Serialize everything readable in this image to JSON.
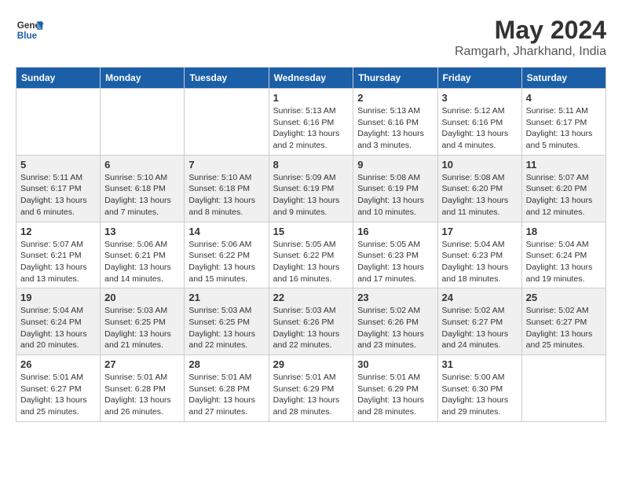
{
  "logo": {
    "line1": "General",
    "line2": "Blue"
  },
  "title": "May 2024",
  "location": "Ramgarh, Jharkhand, India",
  "weekdays": [
    "Sunday",
    "Monday",
    "Tuesday",
    "Wednesday",
    "Thursday",
    "Friday",
    "Saturday"
  ],
  "weeks": [
    [
      {
        "day": "",
        "info": ""
      },
      {
        "day": "",
        "info": ""
      },
      {
        "day": "",
        "info": ""
      },
      {
        "day": "1",
        "info": "Sunrise: 5:13 AM\nSunset: 6:16 PM\nDaylight: 13 hours\nand 2 minutes."
      },
      {
        "day": "2",
        "info": "Sunrise: 5:13 AM\nSunset: 6:16 PM\nDaylight: 13 hours\nand 3 minutes."
      },
      {
        "day": "3",
        "info": "Sunrise: 5:12 AM\nSunset: 6:16 PM\nDaylight: 13 hours\nand 4 minutes."
      },
      {
        "day": "4",
        "info": "Sunrise: 5:11 AM\nSunset: 6:17 PM\nDaylight: 13 hours\nand 5 minutes."
      }
    ],
    [
      {
        "day": "5",
        "info": "Sunrise: 5:11 AM\nSunset: 6:17 PM\nDaylight: 13 hours\nand 6 minutes."
      },
      {
        "day": "6",
        "info": "Sunrise: 5:10 AM\nSunset: 6:18 PM\nDaylight: 13 hours\nand 7 minutes."
      },
      {
        "day": "7",
        "info": "Sunrise: 5:10 AM\nSunset: 6:18 PM\nDaylight: 13 hours\nand 8 minutes."
      },
      {
        "day": "8",
        "info": "Sunrise: 5:09 AM\nSunset: 6:19 PM\nDaylight: 13 hours\nand 9 minutes."
      },
      {
        "day": "9",
        "info": "Sunrise: 5:08 AM\nSunset: 6:19 PM\nDaylight: 13 hours\nand 10 minutes."
      },
      {
        "day": "10",
        "info": "Sunrise: 5:08 AM\nSunset: 6:20 PM\nDaylight: 13 hours\nand 11 minutes."
      },
      {
        "day": "11",
        "info": "Sunrise: 5:07 AM\nSunset: 6:20 PM\nDaylight: 13 hours\nand 12 minutes."
      }
    ],
    [
      {
        "day": "12",
        "info": "Sunrise: 5:07 AM\nSunset: 6:21 PM\nDaylight: 13 hours\nand 13 minutes."
      },
      {
        "day": "13",
        "info": "Sunrise: 5:06 AM\nSunset: 6:21 PM\nDaylight: 13 hours\nand 14 minutes."
      },
      {
        "day": "14",
        "info": "Sunrise: 5:06 AM\nSunset: 6:22 PM\nDaylight: 13 hours\nand 15 minutes."
      },
      {
        "day": "15",
        "info": "Sunrise: 5:05 AM\nSunset: 6:22 PM\nDaylight: 13 hours\nand 16 minutes."
      },
      {
        "day": "16",
        "info": "Sunrise: 5:05 AM\nSunset: 6:23 PM\nDaylight: 13 hours\nand 17 minutes."
      },
      {
        "day": "17",
        "info": "Sunrise: 5:04 AM\nSunset: 6:23 PM\nDaylight: 13 hours\nand 18 minutes."
      },
      {
        "day": "18",
        "info": "Sunrise: 5:04 AM\nSunset: 6:24 PM\nDaylight: 13 hours\nand 19 minutes."
      }
    ],
    [
      {
        "day": "19",
        "info": "Sunrise: 5:04 AM\nSunset: 6:24 PM\nDaylight: 13 hours\nand 20 minutes."
      },
      {
        "day": "20",
        "info": "Sunrise: 5:03 AM\nSunset: 6:25 PM\nDaylight: 13 hours\nand 21 minutes."
      },
      {
        "day": "21",
        "info": "Sunrise: 5:03 AM\nSunset: 6:25 PM\nDaylight: 13 hours\nand 22 minutes."
      },
      {
        "day": "22",
        "info": "Sunrise: 5:03 AM\nSunset: 6:26 PM\nDaylight: 13 hours\nand 22 minutes."
      },
      {
        "day": "23",
        "info": "Sunrise: 5:02 AM\nSunset: 6:26 PM\nDaylight: 13 hours\nand 23 minutes."
      },
      {
        "day": "24",
        "info": "Sunrise: 5:02 AM\nSunset: 6:27 PM\nDaylight: 13 hours\nand 24 minutes."
      },
      {
        "day": "25",
        "info": "Sunrise: 5:02 AM\nSunset: 6:27 PM\nDaylight: 13 hours\nand 25 minutes."
      }
    ],
    [
      {
        "day": "26",
        "info": "Sunrise: 5:01 AM\nSunset: 6:27 PM\nDaylight: 13 hours\nand 25 minutes."
      },
      {
        "day": "27",
        "info": "Sunrise: 5:01 AM\nSunset: 6:28 PM\nDaylight: 13 hours\nand 26 minutes."
      },
      {
        "day": "28",
        "info": "Sunrise: 5:01 AM\nSunset: 6:28 PM\nDaylight: 13 hours\nand 27 minutes."
      },
      {
        "day": "29",
        "info": "Sunrise: 5:01 AM\nSunset: 6:29 PM\nDaylight: 13 hours\nand 28 minutes."
      },
      {
        "day": "30",
        "info": "Sunrise: 5:01 AM\nSunset: 6:29 PM\nDaylight: 13 hours\nand 28 minutes."
      },
      {
        "day": "31",
        "info": "Sunrise: 5:00 AM\nSunset: 6:30 PM\nDaylight: 13 hours\nand 29 minutes."
      },
      {
        "day": "",
        "info": ""
      }
    ]
  ]
}
